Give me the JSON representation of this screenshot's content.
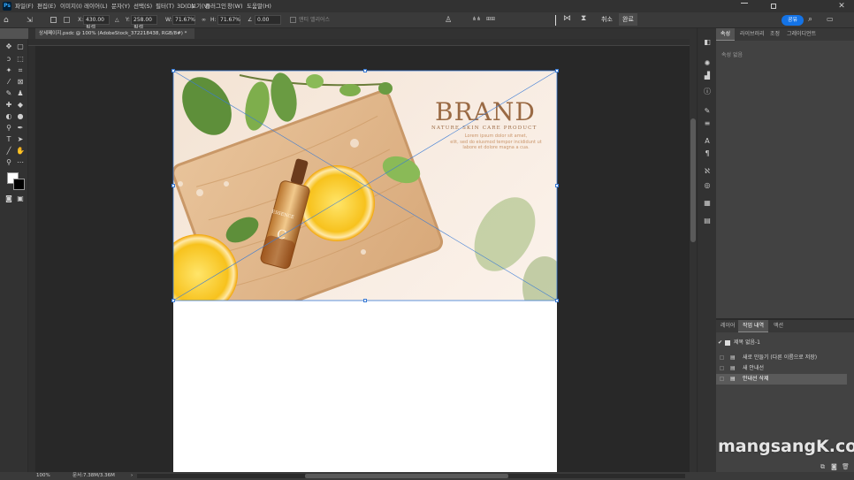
{
  "app": {
    "logo_text": "Ps",
    "menu": [
      "파일(F)",
      "편집(E)",
      "이미지(I)",
      "레이어(L)",
      "문자(Y)",
      "선택(S)",
      "필터(T)",
      "3D(D)",
      "보기(V)",
      "플러그인",
      "창(W)",
      "도움말(H)"
    ]
  },
  "options": {
    "x_label": "X:",
    "x_value": "430.00 픽셀",
    "y_label": "Y:",
    "y_value": "258.00 픽셀",
    "w_label": "W:",
    "w_value": "71.67%",
    "h_label": "H:",
    "h_value": "71.67%",
    "angle_value": "0.00",
    "antialias_label": "앤티 앨리어스",
    "cancel_label": "취소",
    "commit_label": "완료",
    "share_label": "공유"
  },
  "document": {
    "tab_title": "상세페이지.psdc @ 100% (AdobeStock_372218438, RGB/8#) *",
    "close_glyph": "×"
  },
  "artwork": {
    "brand": "BRAND",
    "tagline": "NATURE SKIN CARE PRODUCT",
    "lorem_lines": [
      "Lorem ipsum dolor sit amet,",
      "elit, sed do eiusmod tempor incididunt ut",
      "labore et dolore magna a  cua."
    ],
    "bottle_label": "ESSENCE",
    "bottle_letter": "C"
  },
  "properties_panel": {
    "tabs": [
      "속성",
      "라이브러리",
      "조정",
      "그레이디언트"
    ],
    "empty_text": "속성 없음"
  },
  "layers_panel": {
    "tabs": [
      "레이어",
      "작업 내역",
      "액션"
    ],
    "snapshot": "제목 없음-1",
    "history": [
      "새로 만들기 (다른 이름으로 저장)",
      "새 안내선",
      "안내선 삭제"
    ]
  },
  "status": {
    "zoom": "100%",
    "doc_info": "문서:7.38M/3.36M"
  },
  "watermark": "mangsangK.com",
  "colors": {
    "accent": "#1473e6",
    "brand_text": "#9a6a44",
    "selection": "#3a7bd5"
  }
}
